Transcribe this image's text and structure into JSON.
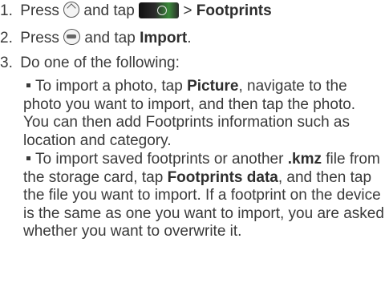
{
  "step1": {
    "num": "1.",
    "press": "Press",
    "and_tap": "and tap",
    "sep": ">",
    "target": "Footprints"
  },
  "step2": {
    "num": "2.",
    "press": "Press",
    "and_tap": "and tap",
    "target": "Import",
    "end": "."
  },
  "step3": {
    "num": "3.",
    "text": "Do one of the following:"
  },
  "bullet1": {
    "a": "To import a photo, tap ",
    "b": "Picture",
    "c": ", navigate to the photo you want to import, and then tap the photo. You can then add Footprints information such as location and category."
  },
  "bullet2": {
    "a": "To import saved footprints or another ",
    "b": ".kmz",
    "c": " file from the storage card, tap ",
    "d": "Footprints data",
    "e": ", and then tap the file you want to import. If a footprint on the device is the same as one you want to import, you are asked whether you want to overwrite it."
  },
  "icons": {
    "home": "home-icon",
    "app": "footprints-app-icon",
    "menu": "menu-icon"
  }
}
